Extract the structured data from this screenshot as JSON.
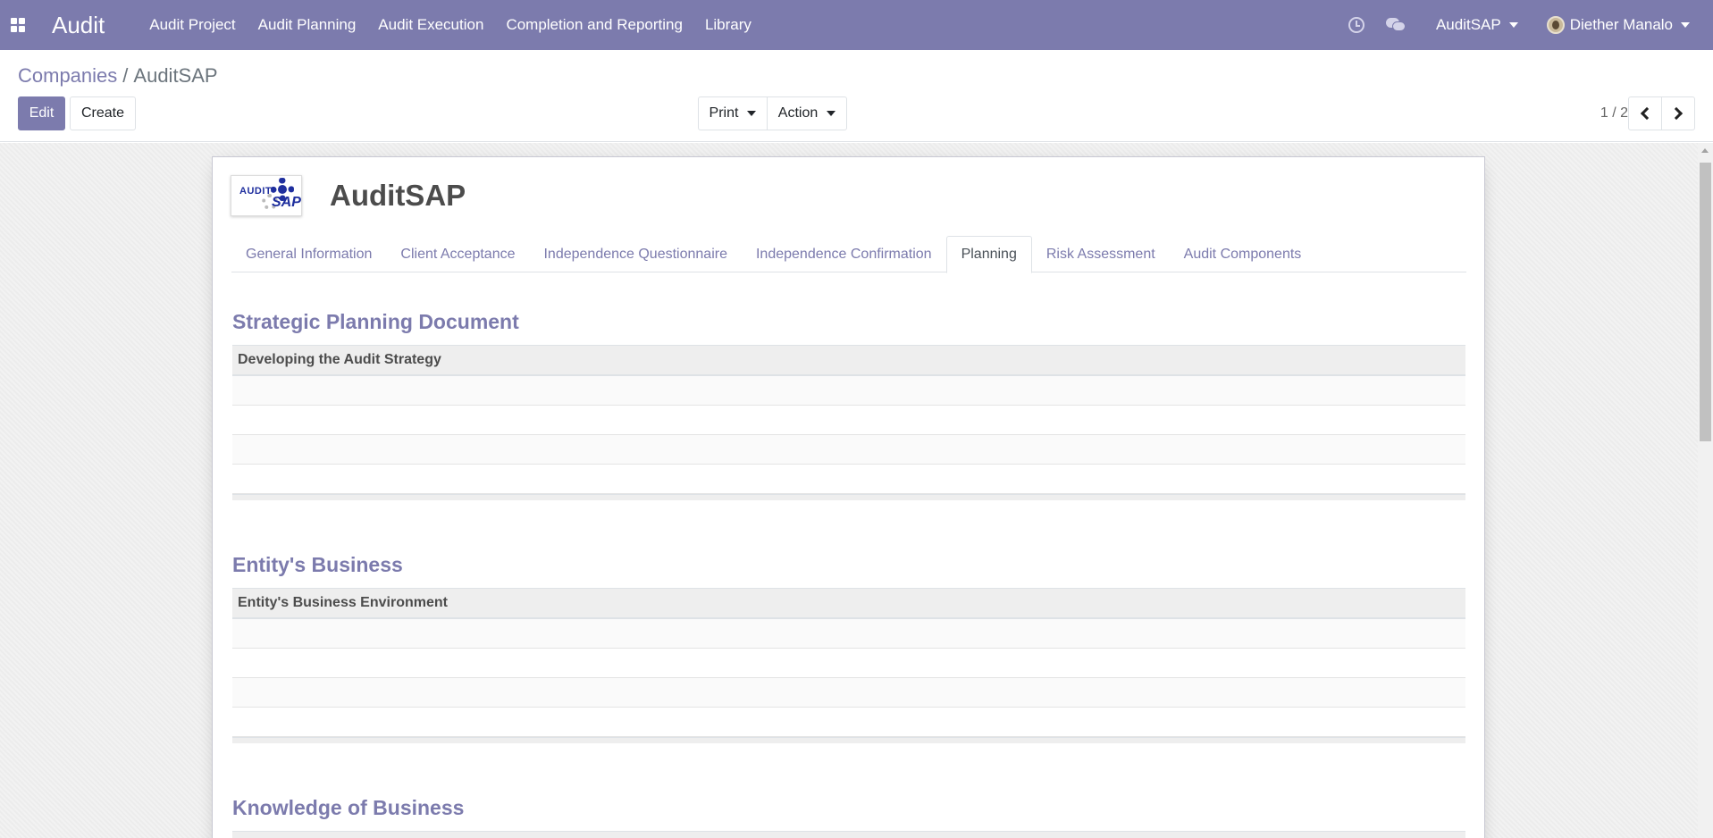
{
  "navbar": {
    "app_title": "Audit",
    "menu": [
      "Audit Project",
      "Audit Planning",
      "Audit Execution",
      "Completion and Reporting",
      "Library"
    ],
    "company": "AuditSAP",
    "user": "Diether Manalo"
  },
  "breadcrumb": {
    "parent": "Companies",
    "separator": "/",
    "current": "AuditSAP"
  },
  "buttons": {
    "edit": "Edit",
    "create": "Create",
    "print": "Print",
    "action": "Action"
  },
  "pager": {
    "value": "1 / 2"
  },
  "record": {
    "title": "AuditSAP",
    "logo_text_1": "AUDIT",
    "logo_text_2": "SAP"
  },
  "tabs": [
    {
      "label": "General Information",
      "active": false
    },
    {
      "label": "Client Acceptance",
      "active": false
    },
    {
      "label": "Independence Questionnaire",
      "active": false
    },
    {
      "label": "Independence Confirmation",
      "active": false
    },
    {
      "label": "Planning",
      "active": true
    },
    {
      "label": "Risk Assessment",
      "active": false
    },
    {
      "label": "Audit Components",
      "active": false
    }
  ],
  "sections": [
    {
      "title": "Strategic Planning Document",
      "column": "Developing the Audit Strategy"
    },
    {
      "title": "Entity's Business",
      "column": "Entity's Business Environment"
    },
    {
      "title": "Knowledge of Business",
      "column": ""
    }
  ]
}
